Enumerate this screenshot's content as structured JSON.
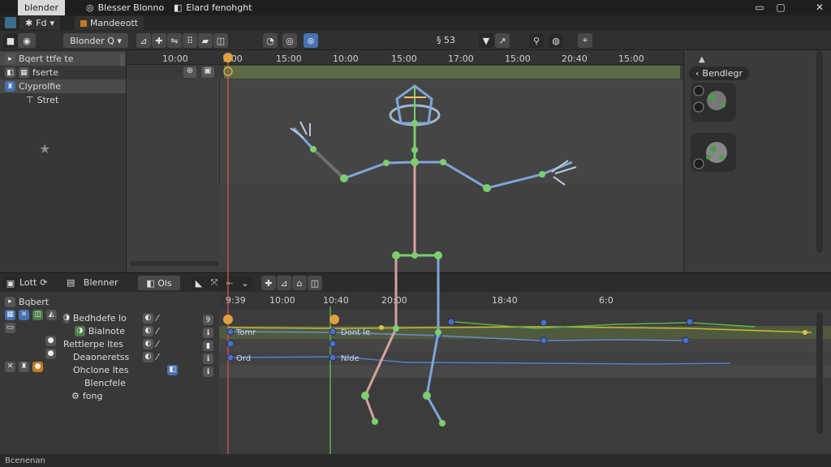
{
  "window": {
    "app_name": "blender",
    "tab_1": "Blesser Blonno",
    "tab_2": "Elard fenohght",
    "controls": [
      "▭",
      "▢",
      "✕"
    ]
  },
  "workspace_tabs": [
    {
      "icon": "✱",
      "label": "Fd"
    },
    {
      "icon": "",
      "label": "Mandeeott"
    }
  ],
  "header": {
    "editor_menu": "Blonder",
    "search_icon": "Q",
    "view_zoom": "§ 53"
  },
  "outliner": {
    "rows": [
      {
        "label": "Bqert  ttfe te",
        "selected": true
      },
      {
        "label": "fserte",
        "selected": false
      },
      {
        "label": "Clyprolfie",
        "selected": true
      },
      {
        "label": "Stret",
        "selected": false
      }
    ]
  },
  "timeline_ruler": {
    "ticks": [
      "10:00",
      "1:00",
      "15:00",
      "10:00",
      "15:00",
      "17:00",
      "15:00",
      "20:40",
      "15:00"
    ]
  },
  "right_panel": {
    "title": "Bendlegr"
  },
  "dope_sheet": {
    "header_items": [
      "Lott",
      "Blenner",
      "Ols"
    ],
    "ruler_ticks": [
      "9:39",
      "10:00",
      "10:40",
      "20:00",
      "18:40",
      "6:0"
    ],
    "channels": [
      {
        "label": "Bqbert",
        "right": "Bedhdefe lo"
      },
      {
        "label": "",
        "right": "Bialnote"
      },
      {
        "label": "",
        "right": "Rettlerpe ltes"
      },
      {
        "label": "",
        "right": "Deaoneretss"
      },
      {
        "label": "",
        "right": "Ohclone ltes"
      },
      {
        "label": "",
        "right": "Blencfele"
      },
      {
        "label": "",
        "right": "fong"
      }
    ],
    "key_labels": [
      "Tomr",
      "Dont le",
      "Ord",
      "Nlde"
    ]
  },
  "status_bar": {
    "text": "Bcenenan"
  },
  "colors": {
    "accent_blue": "#4772b3",
    "playhead": "#d9534f",
    "keyframe_yellow": "#d8c24a",
    "bone_green": "#7ccf6e",
    "bone_blue": "#7fa6d8",
    "bone_pink": "#d8a0a0"
  }
}
